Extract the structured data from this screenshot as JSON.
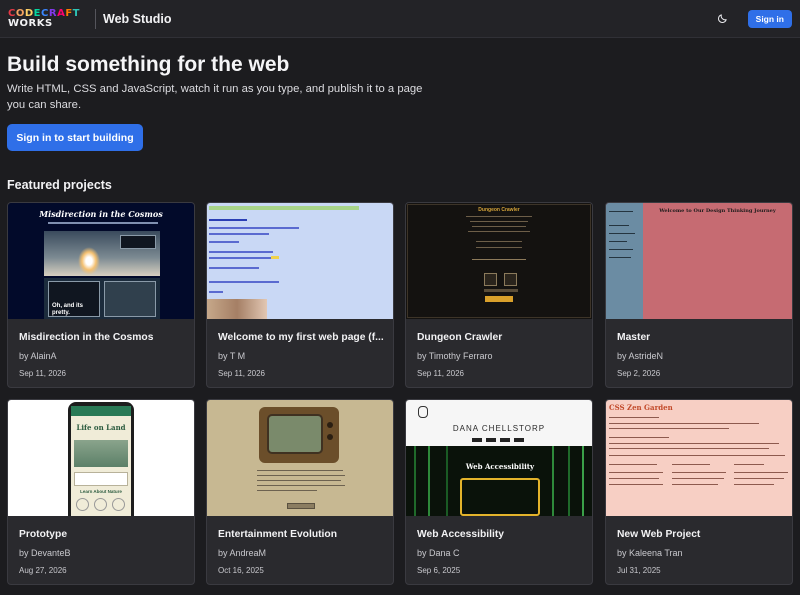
{
  "header": {
    "logo_line1": [
      "C",
      "O",
      "D",
      "E",
      "C",
      "R",
      "A",
      "F",
      "T"
    ],
    "logo_line2": [
      "W",
      "O",
      "R",
      "K",
      "S"
    ],
    "app_title": "Web Studio",
    "theme_icon": "moon-icon",
    "sign_in_label": "Sign in"
  },
  "colors": {
    "accent": "#2f6fe8",
    "background": "#1c1c1f",
    "card": "#2a2a2e",
    "logo": [
      "#e63946",
      "#f4a261",
      "#ffd166",
      "#06d6a0",
      "#3a86ff",
      "#8338ec",
      "#ff006e",
      "#ff7a00",
      "#2ec4b6"
    ]
  },
  "hero": {
    "title": "Build something for the web",
    "description": "Write HTML, CSS and JavaScript, watch it run as you type, and publish it to a page you can share.",
    "cta_label": "Sign in to start building"
  },
  "featured": {
    "title": "Featured projects",
    "projects": [
      {
        "title": "Misdirection in the Cosmos",
        "author": "by AlainA",
        "date": "Sep 11, 2026",
        "thumb_heading": "Misdirection in the Cosmos",
        "thumb_text": [
          "Oh, and its pretty."
        ]
      },
      {
        "title": "Welcome to my first web page (f...",
        "author": "by T M",
        "date": "Sep 11, 2026"
      },
      {
        "title": "Dungeon Crawler",
        "author": "by Timothy Ferraro",
        "date": "Sep 11, 2026",
        "thumb_heading": "Dungeon Crawler"
      },
      {
        "title": "Master",
        "author": "by AstrideN",
        "date": "Sep 2, 2026",
        "thumb_heading": "Welcome to Our Design Thinking Journey"
      },
      {
        "title": "Prototype",
        "author": "by DevanteB",
        "date": "Aug 27, 2026",
        "thumb_heading": "Life on Land",
        "thumb_text": [
          "Learn About Nature"
        ]
      },
      {
        "title": "Entertainment Evolution",
        "author": "by AndreaM",
        "date": "Oct 16, 2025"
      },
      {
        "title": "Web Accessibility",
        "author": "by Dana C",
        "date": "Sep 6, 2025",
        "thumb_heading": "DANA CHELLSTORP",
        "thumb_text": [
          "Web Accessibility"
        ]
      },
      {
        "title": "New Web Project",
        "author": "by Kaleena Tran",
        "date": "Jul 31, 2025",
        "thumb_heading": "CSS Zen Garden"
      }
    ]
  }
}
